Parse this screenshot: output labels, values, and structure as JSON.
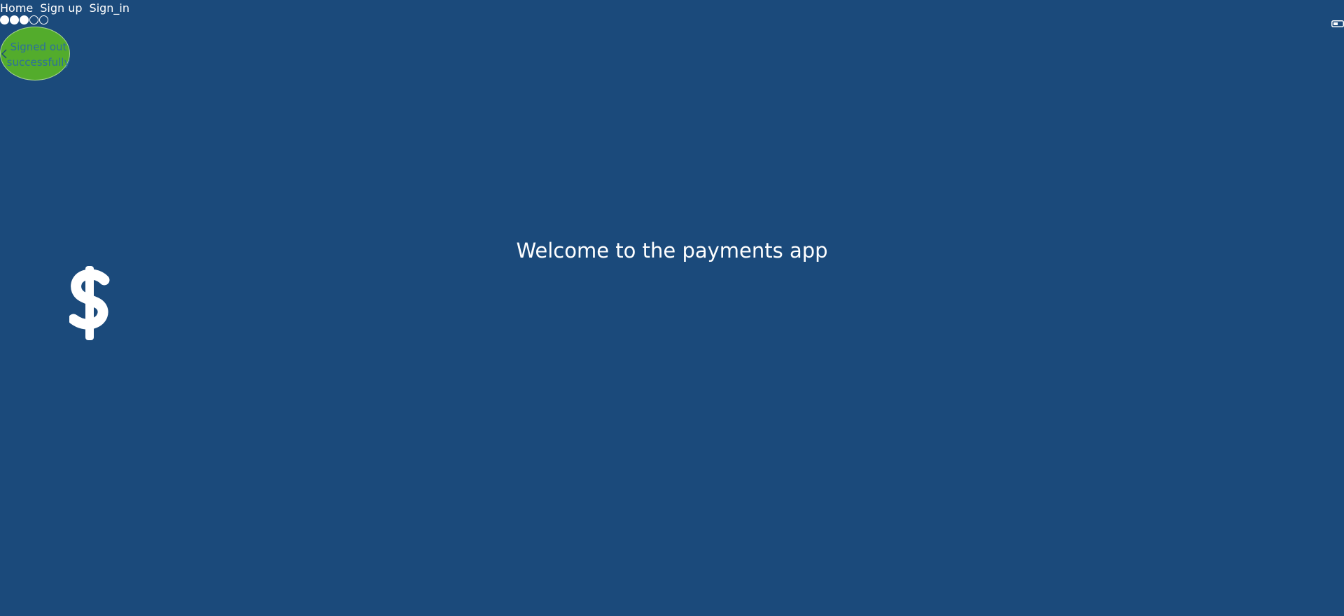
{
  "nav": {
    "home": "Home",
    "sign_up": "Sign up",
    "sign_in": "Sign_in"
  },
  "progress": {
    "filled_steps": 3,
    "total_steps": 5
  },
  "toast": {
    "message": "Signed out successfully",
    "close_icon": "chevron-left-icon",
    "color": "#53ac2c"
  },
  "main": {
    "heading": "Welcome to the payments app",
    "icon": "dollar-icon"
  },
  "colors": {
    "background": "#1b4a7b",
    "text": "#ffffff",
    "toast_bg": "#53ac2c",
    "toast_text": "#2d6f9c"
  },
  "toggle": {
    "icon": "toggle-icon"
  }
}
